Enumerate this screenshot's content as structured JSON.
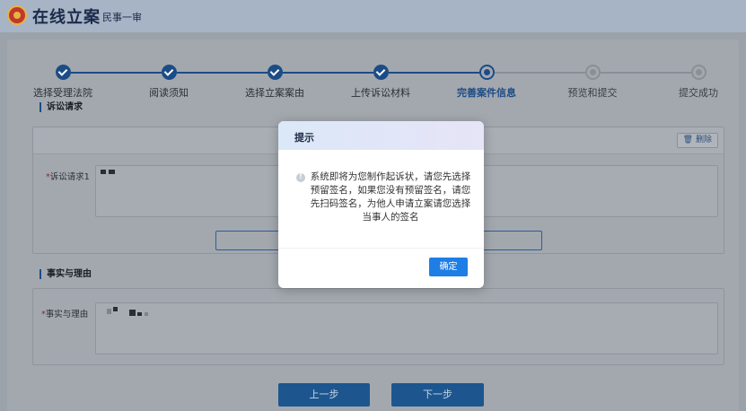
{
  "header": {
    "title": "在线立案",
    "subtitle": "民事一审"
  },
  "steps": [
    {
      "label": "选择受理法院",
      "state": "done"
    },
    {
      "label": "阅读须知",
      "state": "done"
    },
    {
      "label": "选择立案案由",
      "state": "done"
    },
    {
      "label": "上传诉讼材料",
      "state": "done"
    },
    {
      "label": "完善案件信息",
      "state": "active"
    },
    {
      "label": "预览和提交",
      "state": "todo"
    },
    {
      "label": "提交成功",
      "state": "todo"
    }
  ],
  "claims": {
    "section_title": "诉讼请求",
    "delete_label": "删除",
    "field_label": "诉讼请求1",
    "required_mark": "*"
  },
  "facts": {
    "section_title": "事实与理由",
    "field_label": "事实与理由",
    "required_mark": "*"
  },
  "nav": {
    "prev_label": "上一步",
    "next_label": "下一步"
  },
  "modal": {
    "title": "提示",
    "message": "系统即将为您制作起诉状，请您先选择预留签名，如果您没有预留签名，请您先扫码签名，为他人申请立案请您选择当事人的签名",
    "ok_label": "确定"
  },
  "colors": {
    "primary": "#1e7ee6",
    "step_done": "#1c4c86",
    "step_todo": "#8a8f96"
  }
}
